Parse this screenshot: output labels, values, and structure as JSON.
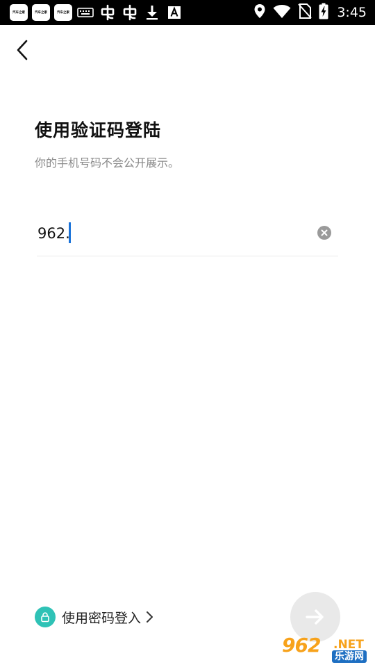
{
  "status_bar": {
    "time": "3:45",
    "app_badges": [
      "汽车之家",
      "汽车之家",
      "汽车之家"
    ],
    "icons": [
      "keyboard-icon",
      "bug-icon",
      "bug-icon",
      "download-icon",
      "a-icon",
      "location-icon",
      "wifi-icon",
      "no-sim-icon",
      "battery-charging-icon"
    ]
  },
  "header": {
    "back_icon": "chevron-left-icon"
  },
  "login": {
    "title": "使用验证码登陆",
    "subtitle": "你的手机号码不会公开展示。",
    "phone_value": "962."
  },
  "footer": {
    "password_login_label": "使用密码登入",
    "lock_icon": "lock-icon",
    "next_icon": "arrow-right-icon"
  },
  "watermark": {
    "number": "962",
    "domain": ".NET",
    "site": "乐游网"
  },
  "colors": {
    "accent_teal": "#2fc2b6",
    "caret_blue": "#1a73d9",
    "watermark_orange": "#f7a21b"
  }
}
